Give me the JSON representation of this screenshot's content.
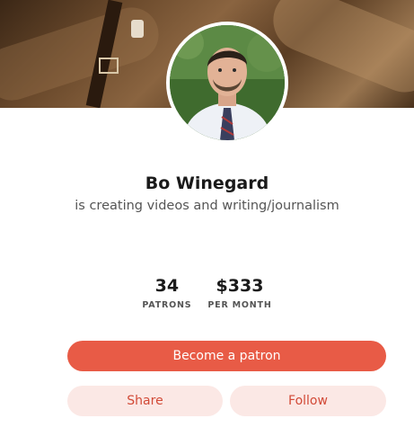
{
  "creator": {
    "name": "Bo Winegard",
    "tagline": "is creating videos and writing/journalism"
  },
  "stats": {
    "patrons_value": "34",
    "patrons_label": "PATRONS",
    "per_month_value": "$333",
    "per_month_label": "PER MONTH"
  },
  "actions": {
    "become_patron": "Become a patron",
    "share": "Share",
    "follow": "Follow"
  },
  "colors": {
    "primary": "#e85b46",
    "secondary_bg": "#fbe8e5",
    "secondary_text": "#d24a37"
  }
}
